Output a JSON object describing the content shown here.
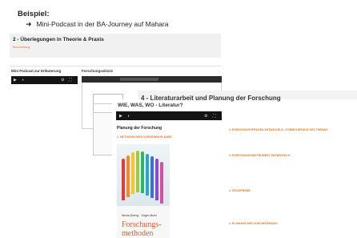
{
  "header": {
    "title": "Beispiel:",
    "subtitle": "Mini-Podcast in der BA-Journey auf Mahara"
  },
  "section": {
    "title": "2 - Überlegungen in Theorie & Praxis",
    "sub": "Beschreibung"
  },
  "left_label": "Mini Podcast zur Erläuterung",
  "sketch_label": "Forschungsskizze",
  "overlay": {
    "title": "4 - Literaturarbeit und Planung der Forschung"
  },
  "doc": {
    "subtitle": "WIE, WAS, WO - Literatur?",
    "planung_title": "Planung der Forschung",
    "methodisches_heading": "1. METHODISCHES VORGEHEN PLANEN",
    "book": {
      "author": "Nicola Döring · Jürgen Bortz",
      "title_line1": "Forschungs-",
      "title_line2": "methoden"
    },
    "right_sections": [
      "2. FORSCHUNGSFRAGEN ENTWICKELN - FORMULIERUNG DES THEMAS",
      "3. FORSCHUNGSINSTRUMENT ENTWICKELN",
      "4. STICHPROBE",
      "4. PLANUNG DER DURCHFÜHRUNG"
    ]
  },
  "colors": {
    "accent": "#e07a21",
    "book_title": "#d6612c"
  }
}
